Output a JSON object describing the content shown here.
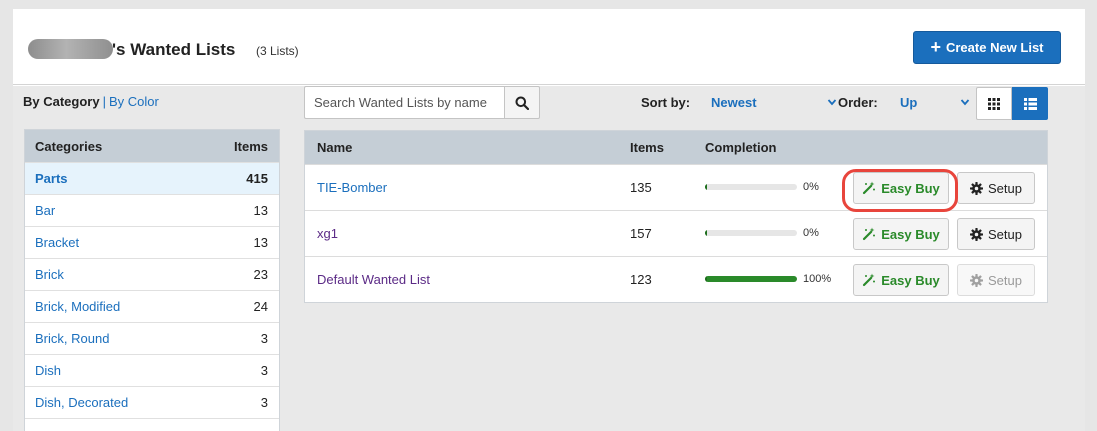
{
  "header": {
    "title": "'s Wanted Lists",
    "count": "(3 Lists)",
    "create_label": "Create New List"
  },
  "sidebar": {
    "active_view": "By Category",
    "separator": "|",
    "alt_view": "By Color",
    "columns": {
      "name": "Categories",
      "items": "Items"
    },
    "categories": [
      {
        "name": "Parts",
        "count": "415",
        "selected": true
      },
      {
        "name": "Bar",
        "count": "13"
      },
      {
        "name": "Bracket",
        "count": "13"
      },
      {
        "name": "Brick",
        "count": "23"
      },
      {
        "name": "Brick, Modified",
        "count": "24"
      },
      {
        "name": "Brick, Round",
        "count": "3"
      },
      {
        "name": "Dish",
        "count": "3"
      },
      {
        "name": "Dish, Decorated",
        "count": "3"
      }
    ]
  },
  "toolbar": {
    "search_placeholder": "Search Wanted Lists by name",
    "sort_label": "Sort by:",
    "sort_value": "Newest",
    "order_label": "Order:",
    "order_value": "Up"
  },
  "lists": {
    "columns": {
      "name": "Name",
      "items": "Items",
      "completion": "Completion"
    },
    "easy_buy_label": "Easy Buy",
    "setup_label": "Setup",
    "rows": [
      {
        "name": "TIE-Bomber",
        "items": "135",
        "completion": "0%",
        "completion_fraction": 0.0
      },
      {
        "name": "xg1",
        "items": "157",
        "completion": "0%",
        "completion_fraction": 0.0
      },
      {
        "name": "Default Wanted List",
        "items": "123",
        "completion": "100%",
        "completion_fraction": 1.0
      }
    ]
  },
  "colors": {
    "accent": "#1b6fbd",
    "success": "#2a8a2a",
    "highlight": "#e8453c"
  }
}
